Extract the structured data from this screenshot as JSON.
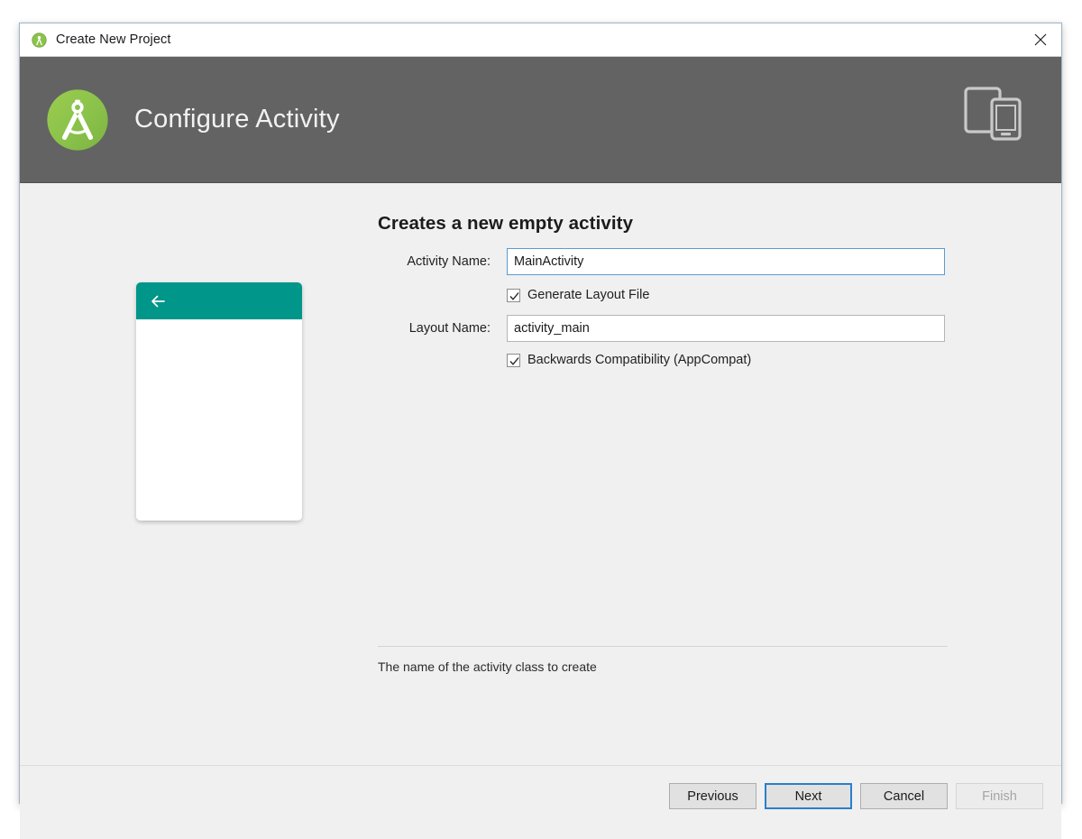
{
  "window": {
    "title": "Create New Project",
    "title_icon": "android-studio-icon",
    "close_icon": "close-icon"
  },
  "banner": {
    "title": "Configure Activity",
    "logo_icon": "android-studio-logo-icon",
    "device_icon": "tablet-phone-icon",
    "background_color": "#636363"
  },
  "main": {
    "heading": "Creates a new empty activity",
    "preview": {
      "appbar_color": "#00968a",
      "back_icon": "arrow-left-icon"
    },
    "fields": [
      {
        "label": "Activity Name:",
        "value": "MainActivity",
        "placeholder": "Activity Name",
        "focused": true
      },
      {
        "label": "Layout Name:",
        "value": "activity_main",
        "placeholder": "Layout Name",
        "focused": false
      }
    ],
    "checkboxes": [
      {
        "label": "Generate Layout File",
        "checked": true
      },
      {
        "label": "Backwards Compatibility (AppCompat)",
        "checked": true
      }
    ],
    "hint": "The name of the activity class to create"
  },
  "footer": {
    "buttons": [
      {
        "label": "Previous",
        "state": "normal"
      },
      {
        "label": "Next",
        "state": "primary"
      },
      {
        "label": "Cancel",
        "state": "normal"
      },
      {
        "label": "Finish",
        "state": "disabled"
      }
    ]
  },
  "colors": {
    "accent_blue": "#2a7fc9",
    "teal": "#00968a",
    "header_grey": "#636363",
    "body_grey": "#f0f0f0"
  }
}
